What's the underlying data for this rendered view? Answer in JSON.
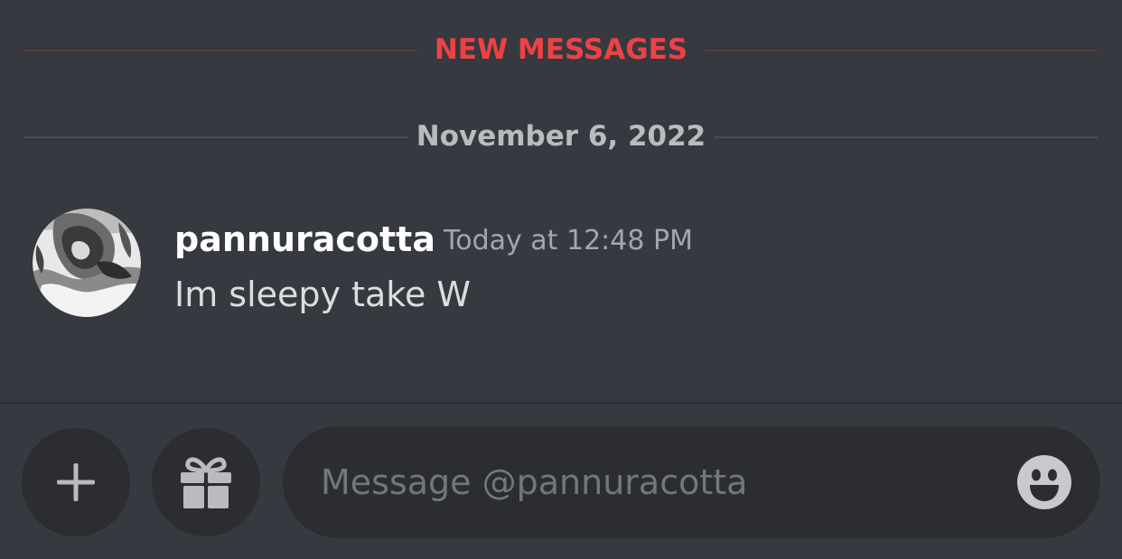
{
  "dividers": {
    "new_messages": "NEW MESSAGES",
    "date": "November 6, 2022"
  },
  "message": {
    "username": "pannuracotta",
    "timestamp": "Today at 12:48 PM",
    "text": "Im sleepy take W",
    "avatar_icon": "avatar-image"
  },
  "composer": {
    "placeholder": "Message @pannuracotta",
    "add_icon": "plus-icon",
    "gift_icon": "gift-icon",
    "emoji_icon": "emoji-icon"
  },
  "colors": {
    "background": "#36393f",
    "new_messages_accent": "#ed4245",
    "input_background": "#2b2d31"
  }
}
